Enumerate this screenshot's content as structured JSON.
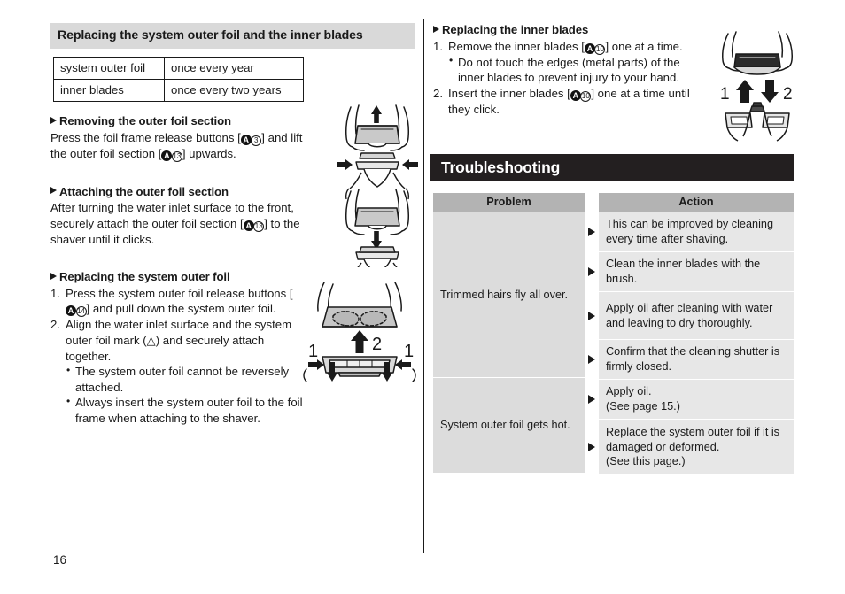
{
  "page": {
    "number": "16"
  },
  "left": {
    "section_title": "Replacing the system outer foil and the inner blades",
    "interval_table": {
      "rows": [
        {
          "part": "system outer foil",
          "interval": "once every year"
        },
        {
          "part": "inner blades",
          "interval": "once every two years"
        }
      ]
    },
    "removing": {
      "heading": "Removing the outer foil section",
      "text_1": "Press the foil frame release buttons [",
      "ref_1_letter": "A",
      "ref_1_number": "3",
      "text_2": "] and lift the outer foil section [",
      "ref_2_letter": "A",
      "ref_2_number": "13",
      "text_3": "] upwards."
    },
    "attaching": {
      "heading": "Attaching the outer foil section",
      "text_1": "After turning the water inlet surface to the front, securely attach the outer foil section [",
      "ref_letter": "A",
      "ref_number": "13",
      "text_2": "] to the shaver until it clicks."
    },
    "replacing_foil": {
      "heading": "Replacing the system outer foil",
      "step_1_marker": "1.",
      "step_1_text_a": "Press the system outer foil release buttons [",
      "step_1_ref_letter": "A",
      "step_1_ref_number": "14",
      "step_1_text_b": "] and pull down the system outer foil.",
      "step_2_marker": "2.",
      "step_2_text": "Align the water inlet surface and the system outer foil mark (△) and securely attach together.",
      "bullets": [
        "The system outer foil cannot be reversely attached.",
        "Always insert the system outer foil to the foil frame when attaching to the shaver."
      ]
    }
  },
  "right": {
    "replacing_blades": {
      "heading": "Replacing the inner blades",
      "step_1_marker": "1.",
      "step_1_text_a": "Remove the inner blades [",
      "step_1_ref_letter": "A",
      "step_1_ref_number": "10",
      "step_1_text_b": "] one at a time.",
      "bullet": "Do not touch the edges (metal parts) of the inner blades to prevent injury to your hand.",
      "step_2_marker": "2.",
      "step_2_text_a": "Insert the inner blades [",
      "step_2_ref_letter": "A",
      "step_2_ref_number": "10",
      "step_2_text_b": "] one at a time until they click."
    },
    "troubleshooting": {
      "title": "Troubleshooting",
      "columns": {
        "problem": "Problem",
        "action": "Action"
      },
      "rows": [
        {
          "problem": "Trimmed hairs fly all over.",
          "actions": [
            "This can be improved by cleaning every time after shaving.",
            "Clean the inner blades with the brush.",
            "Apply oil after cleaning with water and leaving to dry thoroughly.",
            "Confirm that the cleaning shutter is firmly closed."
          ]
        },
        {
          "problem": "System outer foil gets hot.",
          "actions": [
            "Apply oil.\n(See page 15.)",
            "Replace the system outer foil if it is damaged or deformed.\n(See this page.)"
          ]
        }
      ]
    }
  },
  "illustrations": {
    "remove_foil": "remove-outer-foil-illustration",
    "attach_foil": "attach-outer-foil-illustration",
    "replace_foil": "replace-system-outer-foil-illustration",
    "replace_blades": "replace-inner-blades-illustration",
    "labels": {
      "one": "1",
      "two": "2"
    }
  },
  "colors": {
    "section_bar_bg": "#d9d9d9",
    "troubleshoot_bar_bg": "#231f20",
    "table_header_bg": "#b3b3b3",
    "problem_cell_bg": "#dcdcdc",
    "action_cell_bg": "#e7e7e7",
    "text": "#1a1a1a"
  }
}
